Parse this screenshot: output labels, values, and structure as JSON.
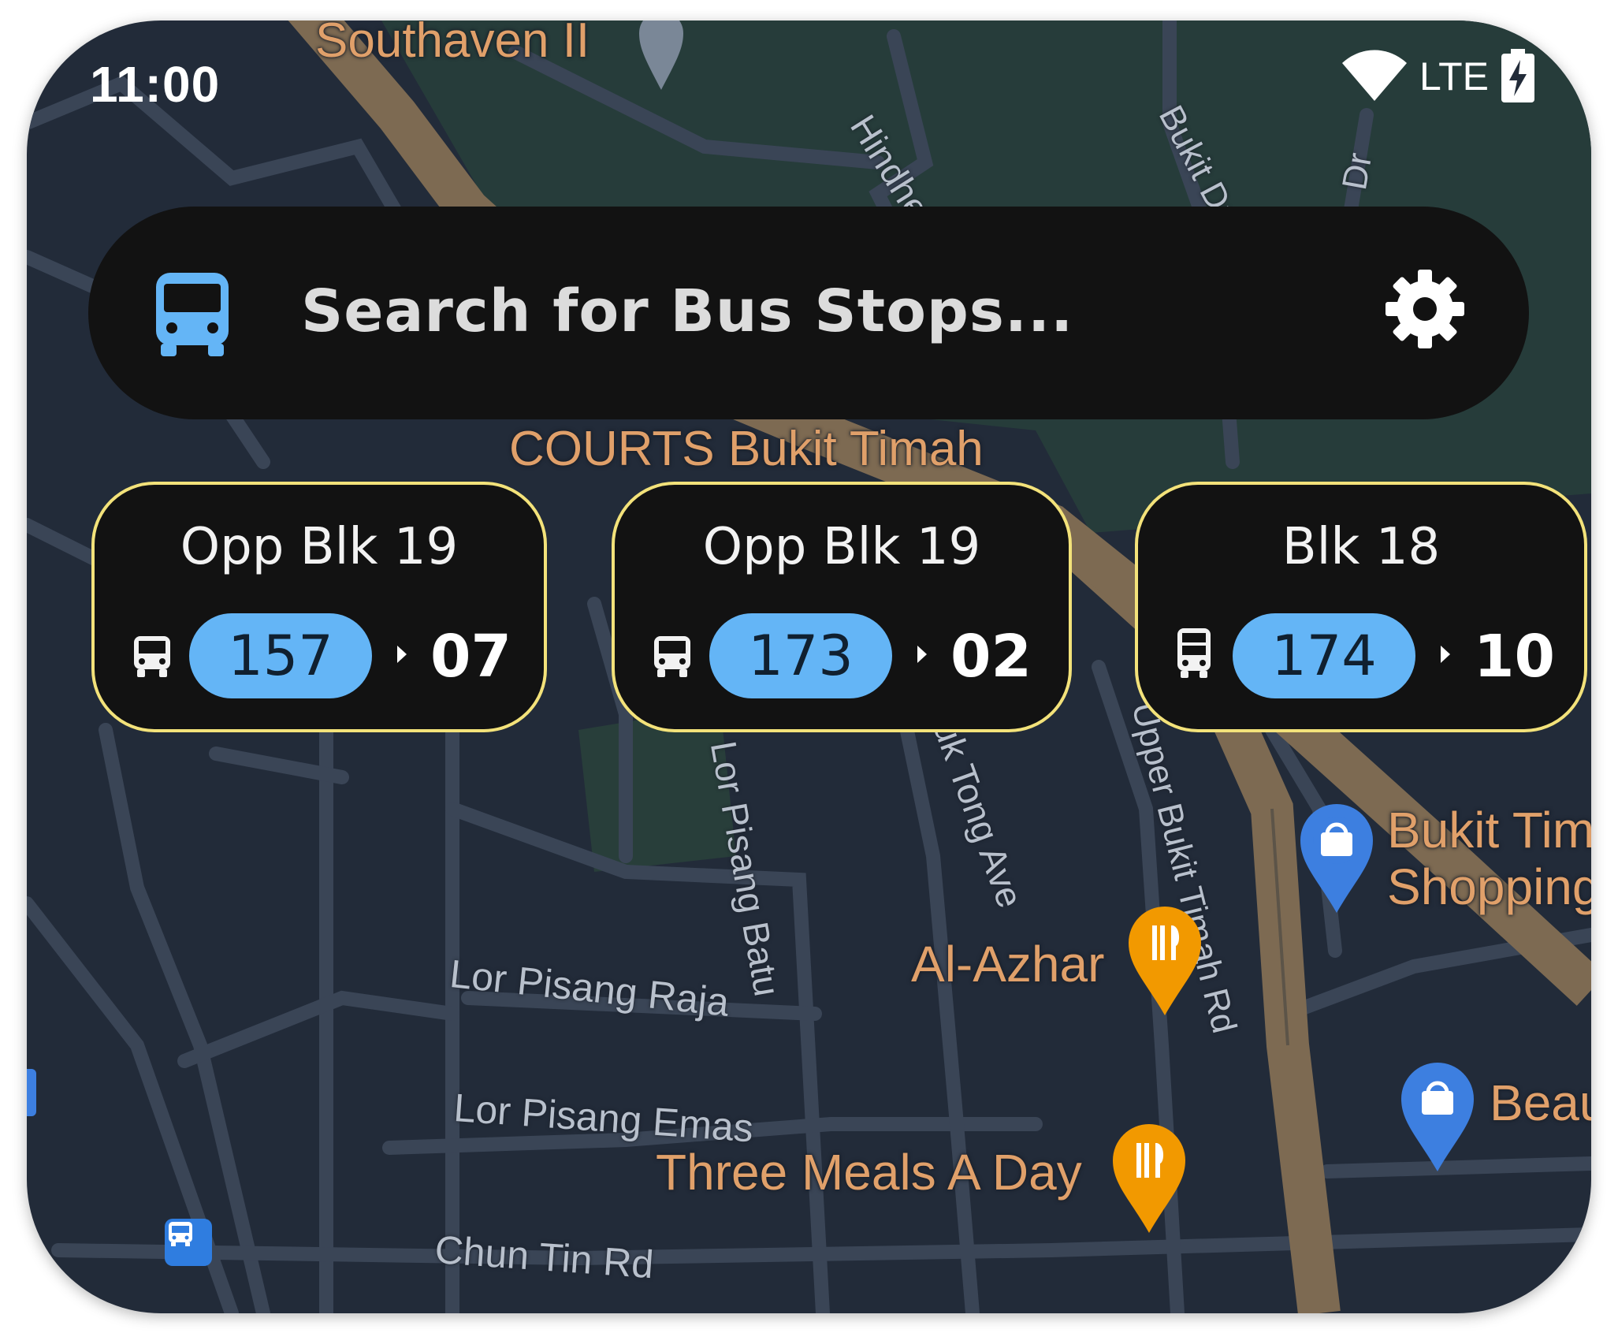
{
  "status_bar": {
    "time": "11:00",
    "network": "LTE",
    "icons": [
      "wifi-icon",
      "battery-charging-icon"
    ]
  },
  "search": {
    "placeholder": "Search for Bus Stops...",
    "leading_icon": "bus-icon",
    "trailing_icon": "gear-icon"
  },
  "cards": [
    {
      "stop_name": "Opp Blk 19",
      "route": "157",
      "eta": "07",
      "bus_icon": "bus-icon"
    },
    {
      "stop_name": "Opp Blk 19",
      "route": "173",
      "eta": "02",
      "bus_icon": "bus-icon"
    },
    {
      "stop_name": "Blk 18",
      "route": "174",
      "eta": "10",
      "bus_icon": "double-decker-bus-icon"
    }
  ],
  "map": {
    "places": {
      "southaven": "Southaven II",
      "courts": "COURTS Bukit Timah",
      "bukit_timah_shopping_1": "Bukit Tim",
      "bukit_timah_shopping_2": "Shopping",
      "al_azhar": "Al-Azhar",
      "three_meals": "Three Meals A Day",
      "beau": "Beau"
    },
    "streets": {
      "hindhede": "Hindhede W",
      "bukit_dr": "Bukit Dr",
      "dr": "Dr",
      "lor_pisang_batu": "Lor Pisang Batu",
      "tong_ave": "uk Tong Ave",
      "upper_bukit_timah": "Upper Bukit Timah Rd",
      "lor_pisang_raja": "Lor Pisang Raja",
      "lor_pisang_emas": "Lor Pisang Emas",
      "chun_tin": "Chun Tin Rd"
    },
    "colors": {
      "background": "#222b39",
      "road": "#3a4556",
      "major_road": "#7d6a52",
      "park": "#263c3a",
      "label": "#e0a06a",
      "pill": "#64b5f6",
      "card_border": "#f3e27a"
    }
  }
}
